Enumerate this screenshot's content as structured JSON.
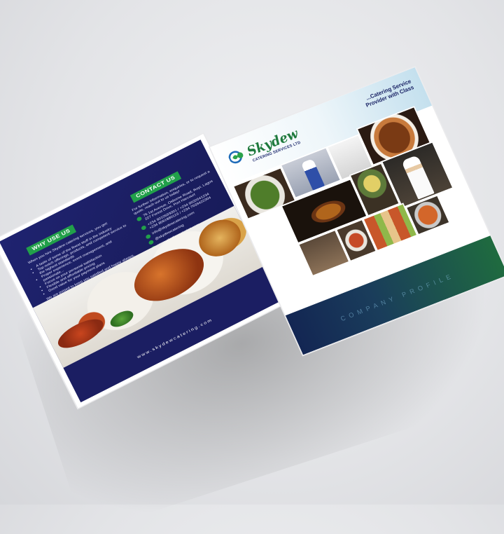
{
  "back_cover": {
    "why_use_us": {
      "heading": "WHY USE US",
      "intro": "When you hire Skydew catering services, you get:",
      "bullets": [
        "A taste of some of the finest stuff in the industry",
        "Top notch offerings, products, and competent service to the highest standards",
        "Proper experience, event management, and passionate...",
        "Focus on your personal satisfaction",
        "Flexible and affordable pricing",
        "Good value for your payment plans"
      ],
      "closing": "We are poised to keep you satisfied and happy always, because we know we are only as good as we make you feel."
    },
    "contact_us": {
      "heading": "CONTACT US",
      "intro": "For further information, enquiries, or to request a quote, reach out to us today!",
      "address": "76 1st Avenue, Osborne Road, Ikoyi, Lagos",
      "address2": "227 Forest Drive, Port Harcourt",
      "phones": "+234 9010593001 / +234 9032541234",
      "phones2": "+234 8091880123 / +234 7039422304",
      "emails": "info@skydewcatering.com",
      "socials": "@skydewcatering",
      "web": "www.skydewcatering.com"
    },
    "website": "www.skydewcatering.com"
  },
  "front_cover": {
    "brand_name": "Skydew",
    "brand_sub": "CATERING SERVICES LTD",
    "tagline_line1": "...Catering Service",
    "tagline_line2": "Provider with Class",
    "footer_text": "COMPANY PROFILE"
  },
  "colors": {
    "navy": "#1f2370",
    "green": "#22a04a",
    "logo_green": "#1f7a3d",
    "background": "#e3e4e7"
  }
}
